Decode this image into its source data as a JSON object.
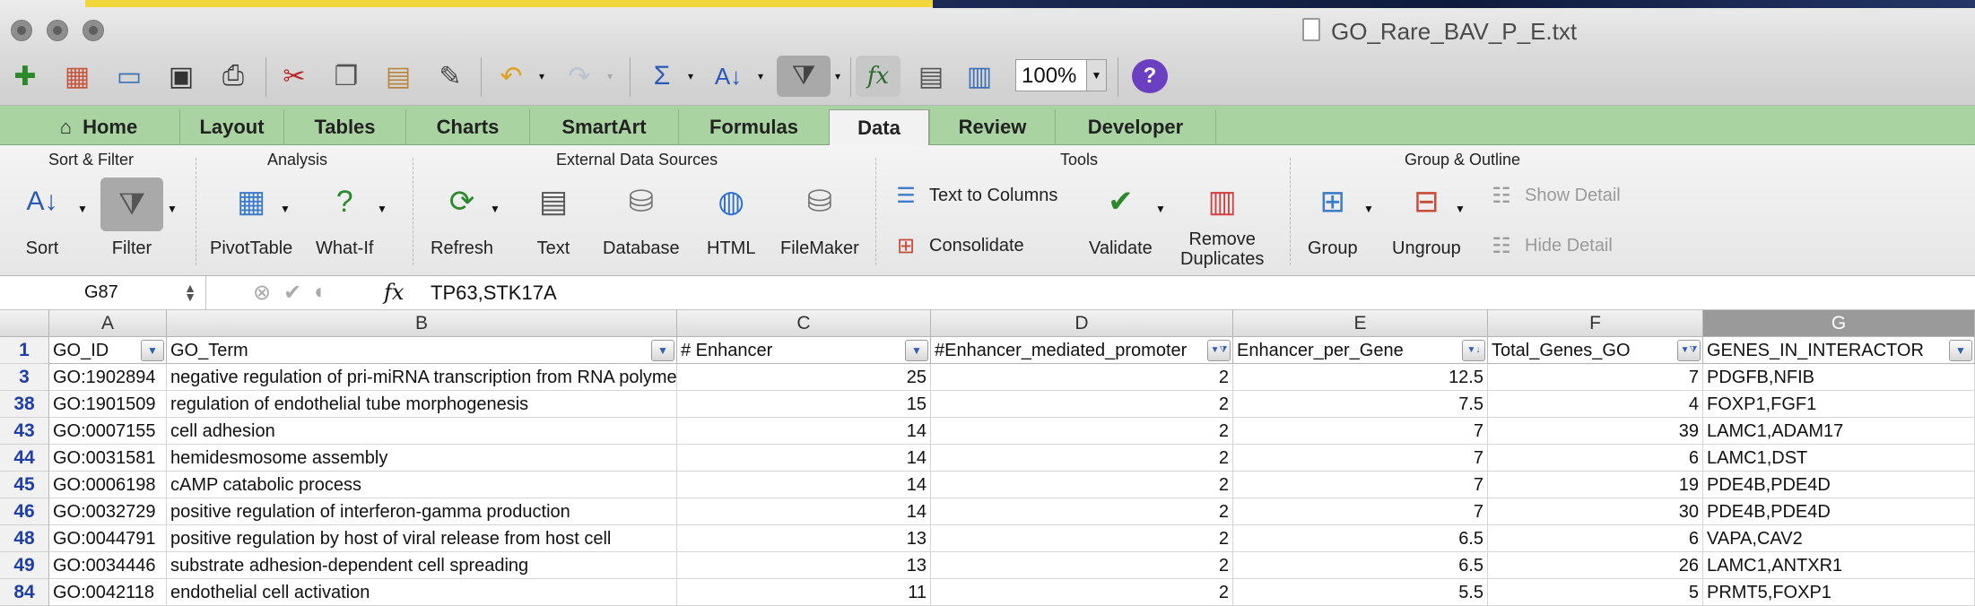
{
  "window": {
    "title": "GO_Rare_BAV_P_E.txt"
  },
  "toolbar": {
    "zoom": "100%"
  },
  "tabs": [
    {
      "label": "Home"
    },
    {
      "label": "Layout"
    },
    {
      "label": "Tables"
    },
    {
      "label": "Charts"
    },
    {
      "label": "SmartArt"
    },
    {
      "label": "Formulas"
    },
    {
      "label": "Data",
      "active": true
    },
    {
      "label": "Review"
    },
    {
      "label": "Developer"
    }
  ],
  "ribbon": {
    "groups": {
      "sort_filter": "Sort & Filter",
      "analysis": "Analysis",
      "external": "External Data Sources",
      "tools": "Tools",
      "group_outline": "Group & Outline"
    },
    "buttons": {
      "sort": "Sort",
      "filter": "Filter",
      "pivottable": "PivotTable",
      "whatif": "What-If",
      "refresh": "Refresh",
      "text": "Text",
      "database": "Database",
      "html": "HTML",
      "filemaker": "FileMaker",
      "text_to_columns": "Text to Columns",
      "consolidate": "Consolidate",
      "validate": "Validate",
      "remove_duplicates_1": "Remove",
      "remove_duplicates_2": "Duplicates",
      "group": "Group",
      "ungroup": "Ungroup",
      "show_detail": "Show Detail",
      "hide_detail": "Hide Detail"
    }
  },
  "formula_bar": {
    "name_box": "G87",
    "formula": "TP63,STK17A"
  },
  "sheet": {
    "columns": [
      "A",
      "B",
      "C",
      "D",
      "E",
      "F",
      "G"
    ],
    "selected_column": "G",
    "headers": [
      "GO_ID",
      "GO_Term",
      "# Enhancer",
      "#Enhancer_mediated_promoter",
      "Enhancer_per_Gene",
      "Total_Genes_GO",
      "GENES_IN_INTERACTOR"
    ],
    "header_row": "1",
    "rows": [
      {
        "num": "3",
        "cells": [
          "GO:1902894",
          "negative regulation of pri-miRNA transcription from RNA polymerase II promoter",
          "25",
          "2",
          "12.5",
          "7",
          "PDGFB,NFIB"
        ]
      },
      {
        "num": "38",
        "cells": [
          "GO:1901509",
          "regulation of endothelial tube morphogenesis",
          "15",
          "2",
          "7.5",
          "4",
          "FOXP1,FGF1"
        ]
      },
      {
        "num": "43",
        "cells": [
          "GO:0007155",
          "cell adhesion",
          "14",
          "2",
          "7",
          "39",
          "LAMC1,ADAM17"
        ]
      },
      {
        "num": "44",
        "cells": [
          "GO:0031581",
          "hemidesmosome assembly",
          "14",
          "2",
          "7",
          "6",
          "LAMC1,DST"
        ]
      },
      {
        "num": "45",
        "cells": [
          "GO:0006198",
          "cAMP catabolic process",
          "14",
          "2",
          "7",
          "19",
          "PDE4B,PDE4D"
        ]
      },
      {
        "num": "46",
        "cells": [
          "GO:0032729",
          "positive regulation of interferon-gamma production",
          "14",
          "2",
          "7",
          "30",
          "PDE4B,PDE4D"
        ]
      },
      {
        "num": "48",
        "cells": [
          "GO:0044791",
          "positive regulation by host of viral release from host cell",
          "13",
          "2",
          "6.5",
          "6",
          "VAPA,CAV2"
        ]
      },
      {
        "num": "49",
        "cells": [
          "GO:0034446",
          "substrate adhesion-dependent cell spreading",
          "13",
          "2",
          "6.5",
          "26",
          "LAMC1,ANTXR1"
        ]
      },
      {
        "num": "84",
        "cells": [
          "GO:0042118",
          "endothelial cell activation",
          "11",
          "2",
          "5.5",
          "5",
          "PRMT5,FOXP1"
        ]
      }
    ]
  }
}
